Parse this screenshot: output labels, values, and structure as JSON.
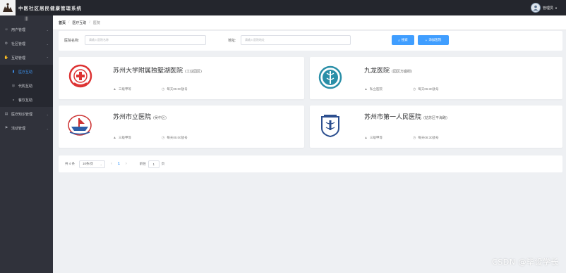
{
  "app": {
    "title": "中医社区居民健康管理系统",
    "user_name": "管理员"
  },
  "sidebar": {
    "collapse_icon": "hamburger-icon",
    "items": [
      {
        "label": "用户管理",
        "icon": "user-icon",
        "expanded": false
      },
      {
        "label": "社区管理",
        "icon": "gear-icon",
        "expanded": false
      },
      {
        "label": "互助管理",
        "icon": "handshake-icon",
        "expanded": true,
        "children": [
          {
            "label": "医疗互助",
            "icon": "doc-icon",
            "active": true
          },
          {
            "label": "代购互助",
            "icon": "cart-icon",
            "active": false
          },
          {
            "label": "餐饮互助",
            "icon": "bowl-icon",
            "active": false
          }
        ]
      },
      {
        "label": "医疗知识管理",
        "icon": "book-icon",
        "expanded": false
      },
      {
        "label": "活动管理",
        "icon": "flag-icon",
        "expanded": false
      }
    ]
  },
  "breadcrumb": [
    "首页",
    "医疗互助",
    "医院"
  ],
  "search": {
    "name_label": "医院名称:",
    "name_placeholder": "请输入医院名称",
    "address_label": "地址:",
    "address_placeholder": "请输入医院地址",
    "search_button": "搜索",
    "add_button": "添加医院"
  },
  "hospitals": [
    {
      "name": "苏州大学附属独墅湖医院",
      "area": "(工业园区)",
      "level": "三级甲等",
      "hours": "每天05:00放号",
      "logo": "red-cross-emblem-icon"
    },
    {
      "name": "九龙医院",
      "area": "(园区万盛街)",
      "level": "私立医院",
      "hours": "每天06:30放号",
      "logo": "teal-caduceus-emblem-icon"
    },
    {
      "name": "苏州市立医院",
      "area": "(吴中区)",
      "level": "三级甲等",
      "hours": "每天05:00放号",
      "logo": "red-ship-emblem-icon"
    },
    {
      "name": "苏州市第一人民医院",
      "area": "(姑苏区平海路)",
      "level": "三级甲等",
      "hours": "每天08:30放号",
      "logo": "blue-shield-emblem-icon"
    }
  ],
  "pagination": {
    "total": "共 4 条",
    "page_size": "10条/页",
    "current_page": "1",
    "goto_label": "前往",
    "goto_value": "1",
    "page_label": "页"
  },
  "watermark": "CSDN @毕设学长",
  "colors": {
    "accent": "#409eff",
    "sidebar_bg": "#30323b",
    "topbar_bg": "#24262d"
  }
}
